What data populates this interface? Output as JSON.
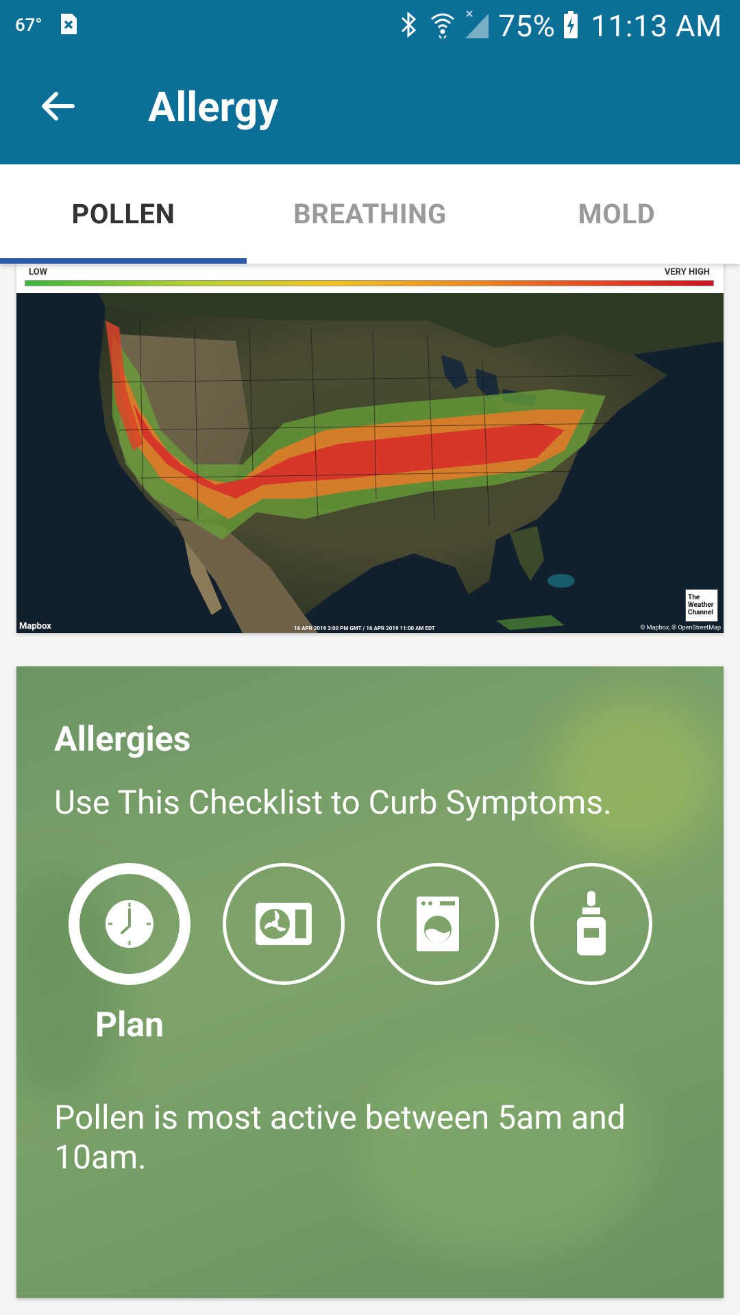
{
  "status_bar": {
    "temperature": "67°",
    "battery_percent": "75%",
    "time": "11:13 AM",
    "icons": [
      "notification-x-icon",
      "bluetooth-icon",
      "wifi-icon",
      "signal-icon",
      "battery-charging-icon"
    ]
  },
  "app_bar": {
    "title": "Allergy",
    "back_icon": "arrow-back-icon"
  },
  "tabs": [
    {
      "label": "POLLEN",
      "selected": true
    },
    {
      "label": "BREATHING",
      "selected": false
    },
    {
      "label": "MOLD",
      "selected": false
    }
  ],
  "map": {
    "legend_low": "LOW",
    "legend_high": "VERY HIGH",
    "provider": "Mapbox",
    "timestamp": "16 APR 2019 3:00 PM GMT / 16 APR 2019 11:00 AM EDT",
    "attribution": "© Mapbox, © OpenStreetMap",
    "logo_text": [
      "The",
      "Weather",
      "Channel"
    ]
  },
  "allergies_card": {
    "heading": "Allergies",
    "subheading": "Use This Checklist to Curb Symptoms.",
    "icons": [
      {
        "name": "clock-icon",
        "label": "Plan",
        "selected": true
      },
      {
        "name": "air-conditioner-icon",
        "label": "",
        "selected": false
      },
      {
        "name": "washing-machine-icon",
        "label": "",
        "selected": false
      },
      {
        "name": "nasal-spray-icon",
        "label": "",
        "selected": false
      }
    ],
    "selected_label": "Plan",
    "tip": "Pollen is most active between 5am and 10am."
  },
  "colors": {
    "primary": "#0b6f97",
    "tab_indicator": "#2a5cad",
    "card_green": "#7ea46a"
  }
}
